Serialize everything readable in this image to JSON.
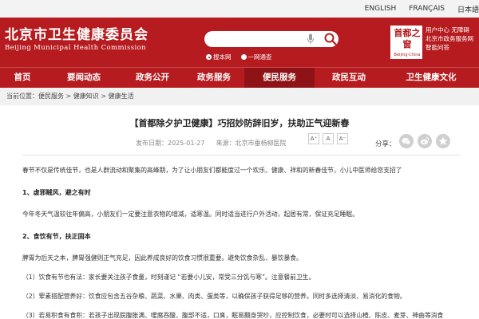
{
  "top_links": [
    "ENGLISH",
    "FRANÇAIS",
    "日本語"
  ],
  "header": {
    "title_cn": "北京市卫生健康委员会",
    "title_en": "Beijing Municipal Health Commission",
    "search_placeholder": "",
    "radio_this_site": "搜本网",
    "radio_all_site": "一网通查",
    "logo_text": "首都之窗",
    "logo_caption": "Beijing·China",
    "quick_links": [
      "用户中心 无障碍",
      "北京市政务服务网",
      "智能问答"
    ]
  },
  "nav": {
    "items": [
      "首页",
      "要闻动态",
      "政务公开",
      "政务服务",
      "便民服务",
      "政民互动",
      "卫生健康文化"
    ],
    "active_index": 4
  },
  "breadcrumb": {
    "prefix": "当前位置：",
    "items": [
      "便民服务",
      "健康知识",
      "健康生活"
    ],
    "sep": " > "
  },
  "article": {
    "title": "【首都除夕护卫健康】巧招妙防辞旧岁，扶助正气迎新春",
    "publish_date": "发布日期：2025-01-27",
    "source": "来源：北京市垂杨柳医院",
    "font_large": "A⁺",
    "font_mid": "A",
    "font_small": "A⁻",
    "share_label": "分享：",
    "paragraphs": [
      {
        "type": "text",
        "text": "春节不仅是传统佳节，也是人群流动和聚集的高峰期，为了让小朋友们都能度过一个欢乐、健康、祥和的新春佳节，小儿中医师给您支招了"
      },
      {
        "type": "heading",
        "text": "1、虚邪贼风，避之有时"
      },
      {
        "type": "text",
        "text": "今年冬天气温较往年偏高，小朋友们一定要注意衣物的增减，适寒温。同时适当进行户外活动，起居有常，保证充足睡眠。"
      },
      {
        "type": "heading",
        "text": "2、食饮有节，扶正固本"
      },
      {
        "type": "text",
        "text": "脾胃为后天之本，脾胃强健则正气充足，因此养成良好的饮食习惯很重要。避免饮食杂乱、暴饮暴食。"
      },
      {
        "type": "text",
        "text": "（1）饮食有节也有法：家长要关注孩子食量，时刻谨记 “若要小儿安，常受三分饥与寒”。注意餐前卫生。"
      },
      {
        "type": "text",
        "text": "（2）荤素搭配营养好：饮食应包含五谷杂粮、蔬菜、水果、肉类、蛋类等，以确保孩子获得足够的营养。同时多选择清淡、易消化的食物。"
      },
      {
        "type": "text",
        "text": "（3）若易积食有食积：若孩子出现脘腹胀满、嗳腐吞酸、腹部不适，口臭，眠易翻身哭吵，应控制饮食，必要时可以选择山楂、陈皮、麦芽、神曲等消食"
      }
    ]
  },
  "colors": {
    "brand_red": "#b61b1f",
    "nav_active": "#8e1216"
  }
}
